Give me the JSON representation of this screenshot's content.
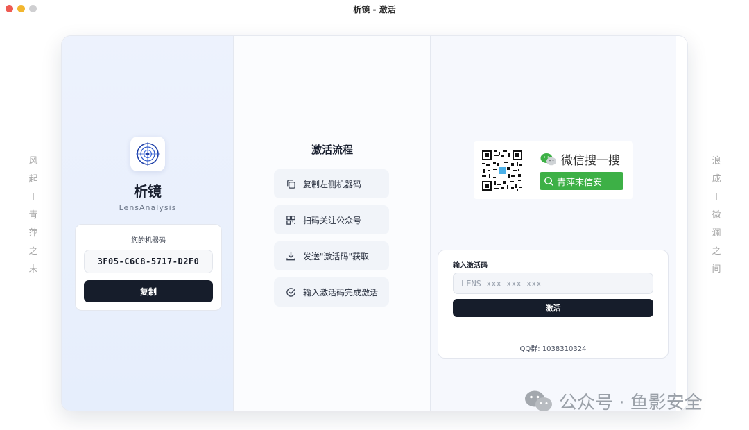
{
  "window": {
    "title": "析镜 - 激活"
  },
  "side_poems": {
    "left": [
      "风",
      "起",
      "于",
      "青",
      "萍",
      "之",
      "末"
    ],
    "right": [
      "浪",
      "成",
      "于",
      "微",
      "澜",
      "之",
      "间"
    ]
  },
  "left_panel": {
    "app_name": "析镜",
    "app_subtitle": "LensAnalysis",
    "machine_label": "您的机器码",
    "machine_code": "3F05-C6C8-5717-D2F0",
    "copy_label": "复制"
  },
  "middle_panel": {
    "title": "激活流程",
    "steps": [
      {
        "label": "复制左侧机器码",
        "icon": "copy-icon"
      },
      {
        "label": "扫码关注公众号",
        "icon": "qr-scan-icon"
      },
      {
        "label": "发送\"激活码\"获取",
        "icon": "download-icon"
      },
      {
        "label": "输入激活码完成激活",
        "icon": "check-circle-icon"
      }
    ]
  },
  "right_panel": {
    "promo": {
      "wechat_text": "微信搜一搜",
      "search_text": "青萍末信安"
    },
    "activation": {
      "label": "输入激活码",
      "placeholder": "LENS-xxx-xxx-xxx",
      "value": "",
      "button_label": "激活",
      "qq_text": "QQ群: 1038310324"
    }
  },
  "watermark": {
    "text": "公众号 · 鱼影安全"
  },
  "colors": {
    "primary_button": "#161d2b",
    "wechat_green": "#3db046",
    "left_panel_bg": "#edf2fd"
  }
}
